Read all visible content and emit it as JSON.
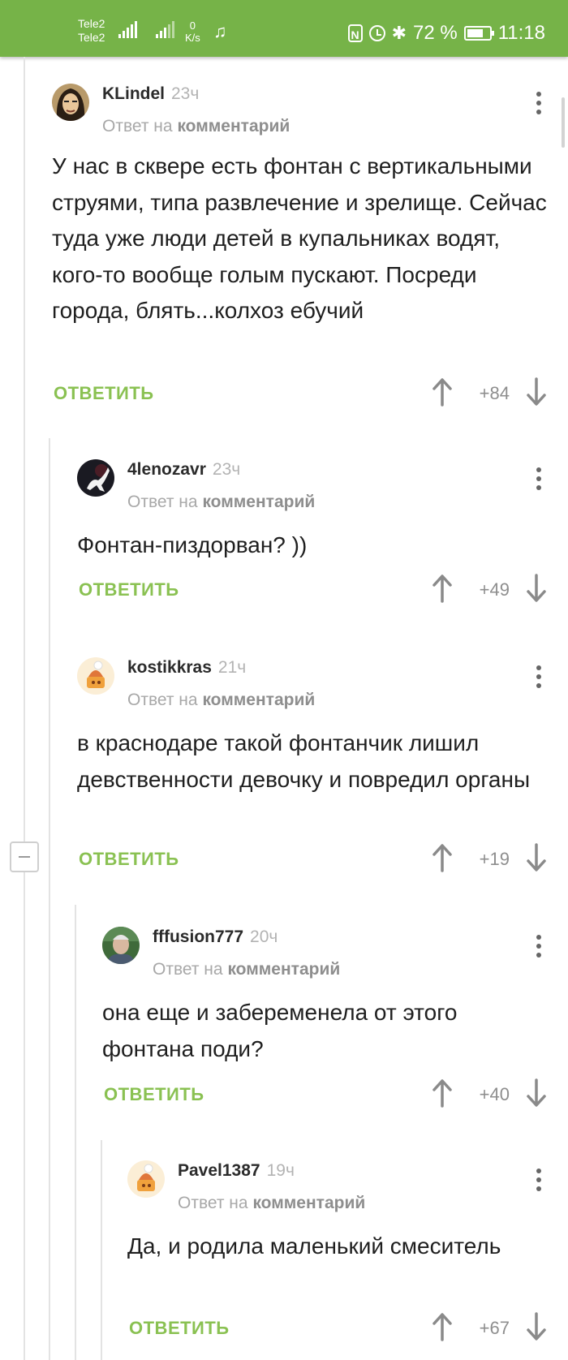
{
  "status_bar": {
    "carrier1": "Tele2",
    "carrier2": "Tele2",
    "net_speed_value": "0",
    "net_speed_unit": "K/s",
    "battery_percent": "72 %",
    "battery_level": 0.72,
    "time": "11:18",
    "icons": [
      "signal-icon",
      "music-icon",
      "nfc-icon",
      "alarm-icon",
      "bluetooth-icon",
      "battery-icon"
    ]
  },
  "colors": {
    "status_bar": "#76b348",
    "reply_action": "#8ac152"
  },
  "comments": [
    {
      "author": "KLindel",
      "time": "23ч",
      "reply_to_prefix": "Ответ на",
      "reply_to_link": "комментарий",
      "text": "У нас в сквере есть фонтан с вертикальными струями, типа развлечение и зрелище. Сейчас туда уже люди детей в купальниках водят, кого-то вообще голым пускают. Посреди города, блять...колхоз ебучий",
      "reply_label": "ОТВЕТИТЬ",
      "score": "+84"
    },
    {
      "author": "4lenozavr",
      "time": "23ч",
      "reply_to_prefix": "Ответ на",
      "reply_to_link": "комментарий",
      "text": "Фонтан-пиздорван? ))",
      "reply_label": "ОТВЕТИТЬ",
      "score": "+49"
    },
    {
      "author": "kostikkras",
      "time": "21ч",
      "reply_to_prefix": "Ответ на",
      "reply_to_link": "комментарий",
      "text": "в краснодаре такой фонтанчик лишил девственности девочку и повредил органы",
      "reply_label": "ОТВЕТИТЬ",
      "score": "+19"
    },
    {
      "author": "fffusion777",
      "time": "20ч",
      "reply_to_prefix": "Ответ на",
      "reply_to_link": "комментарий",
      "text": "она еще и забеременела от этого фонтана поди?",
      "reply_label": "ОТВЕТИТЬ",
      "score": "+40"
    },
    {
      "author": "Pavel1387",
      "time": "19ч",
      "reply_to_prefix": "Ответ на",
      "reply_to_link": "комментарий",
      "text": "Да, и родила маленький смеситель",
      "reply_label": "ОТВЕТИТЬ",
      "score": "+67"
    }
  ]
}
